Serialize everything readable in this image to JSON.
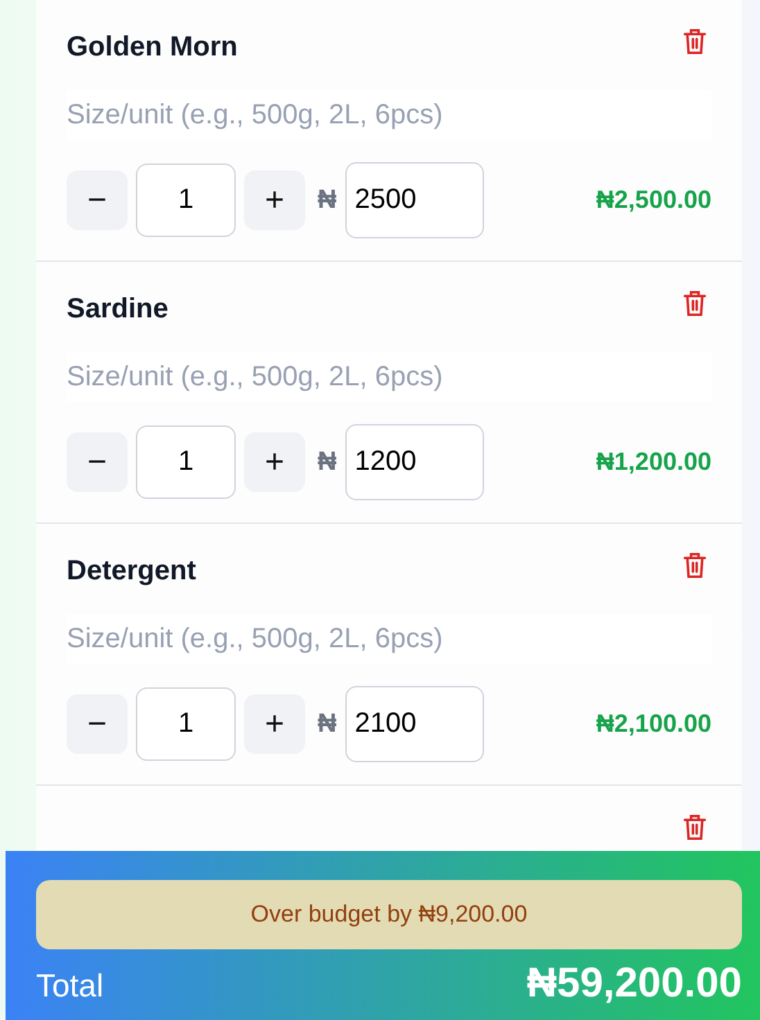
{
  "items": [
    {
      "name": "Golden Morn",
      "size_placeholder": "Size/unit (e.g., 500g, 2L, 6pcs)",
      "quantity": "1",
      "currency": "₦",
      "price": "2500",
      "line_total": "₦2,500.00"
    },
    {
      "name": "Sardine",
      "size_placeholder": "Size/unit (e.g., 500g, 2L, 6pcs)",
      "quantity": "1",
      "currency": "₦",
      "price": "1200",
      "line_total": "₦1,200.00"
    },
    {
      "name": "Detergent",
      "size_placeholder": "Size/unit (e.g., 500g, 2L, 6pcs)",
      "quantity": "1",
      "currency": "₦",
      "price": "2100",
      "line_total": "₦2,100.00"
    }
  ],
  "controls": {
    "decrease": "−",
    "increase": "+"
  },
  "summary": {
    "budget_message": "Over budget by ₦9,200.00",
    "total_label": "Total",
    "total_value": "₦59,200.00"
  }
}
